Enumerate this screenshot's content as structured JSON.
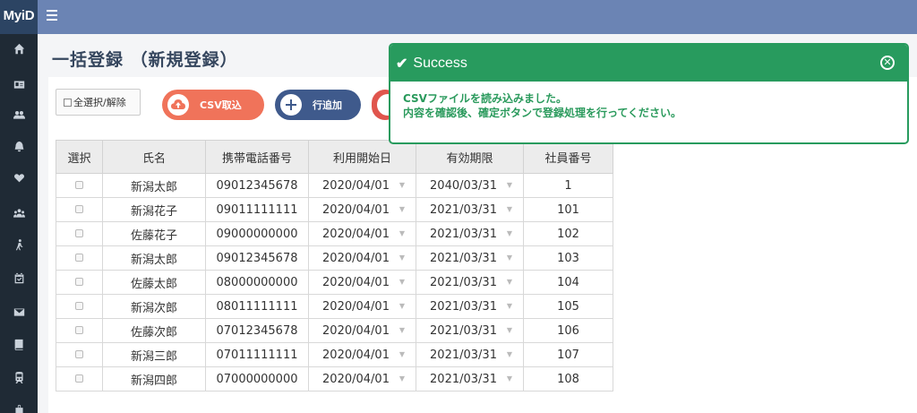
{
  "brand": "MyiD",
  "page_title": "一括登録 （新規登録）",
  "sidebar": {
    "items": [
      {
        "icon": "home-icon"
      },
      {
        "icon": "id-card-icon"
      },
      {
        "icon": "users-icon"
      },
      {
        "icon": "bell-icon"
      },
      {
        "icon": "heart-icon"
      },
      {
        "icon": "group-icon"
      },
      {
        "icon": "walking-icon"
      },
      {
        "icon": "calendar-check-icon"
      },
      {
        "icon": "envelope-icon"
      },
      {
        "icon": "book-icon"
      },
      {
        "icon": "train-icon"
      },
      {
        "icon": "bag-icon"
      }
    ]
  },
  "toolbar": {
    "select_all_label": "全選択/解除",
    "csv_label": "CSV取込",
    "add_row_label": "行追加"
  },
  "table": {
    "headers": [
      "選択",
      "氏名",
      "携帯電話番号",
      "利用開始日",
      "有効期限",
      "社員番号"
    ],
    "rows": [
      {
        "name": "新潟太郎",
        "phone": "09012345678",
        "start": "2020/04/01",
        "expiry": "2040/03/31",
        "emp_no": "1"
      },
      {
        "name": "新潟花子",
        "phone": "09011111111",
        "start": "2020/04/01",
        "expiry": "2021/03/31",
        "emp_no": "101"
      },
      {
        "name": "佐藤花子",
        "phone": "09000000000",
        "start": "2020/04/01",
        "expiry": "2021/03/31",
        "emp_no": "102"
      },
      {
        "name": "新潟太郎",
        "phone": "09012345678",
        "start": "2020/04/01",
        "expiry": "2021/03/31",
        "emp_no": "103"
      },
      {
        "name": "佐藤太郎",
        "phone": "08000000000",
        "start": "2020/04/01",
        "expiry": "2021/03/31",
        "emp_no": "104"
      },
      {
        "name": "新潟次郎",
        "phone": "08011111111",
        "start": "2020/04/01",
        "expiry": "2021/03/31",
        "emp_no": "105"
      },
      {
        "name": "佐藤次郎",
        "phone": "07012345678",
        "start": "2020/04/01",
        "expiry": "2021/03/31",
        "emp_no": "106"
      },
      {
        "name": "新潟三郎",
        "phone": "07011111111",
        "start": "2020/04/01",
        "expiry": "2021/03/31",
        "emp_no": "107"
      },
      {
        "name": "新潟四郎",
        "phone": "07000000000",
        "start": "2020/04/01",
        "expiry": "2021/03/31",
        "emp_no": "108"
      }
    ]
  },
  "toast": {
    "title": "Success",
    "line1": "CSVファイルを読み込みました。",
    "line2": "内容を確認後、確定ボタンで登録処理を行ってください。"
  },
  "colors": {
    "topbar": "#6b84b4",
    "sidebar": "#1f2a35",
    "brand_bg": "#2c4463",
    "success": "#289b5e",
    "csv_button": "#f0735a",
    "add_button": "#3f5a8c",
    "delete_button": "#e0554d"
  }
}
